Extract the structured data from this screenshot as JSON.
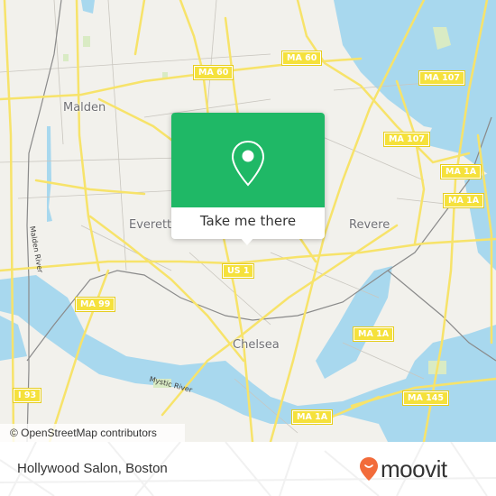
{
  "map": {
    "places": [
      {
        "id": "malden",
        "label": "Malden"
      },
      {
        "id": "everett",
        "label": "Everett"
      },
      {
        "id": "revere",
        "label": "Revere"
      },
      {
        "id": "chelsea",
        "label": "Chelsea"
      }
    ],
    "shields": [
      {
        "id": "ma60-a",
        "label": "MA 60"
      },
      {
        "id": "ma60-b",
        "label": "MA 60"
      },
      {
        "id": "ma107-a",
        "label": "MA 107"
      },
      {
        "id": "ma107-b",
        "label": "MA 107"
      },
      {
        "id": "ma1a-a",
        "label": "MA 1A"
      },
      {
        "id": "ma1a-b",
        "label": "MA 1A"
      },
      {
        "id": "ma1a-c",
        "label": "MA 1A"
      },
      {
        "id": "us1",
        "label": "US 1"
      },
      {
        "id": "ma99",
        "label": "MA 99"
      },
      {
        "id": "i93",
        "label": "I 93"
      },
      {
        "id": "ma145",
        "label": "MA 145"
      }
    ],
    "rivers": [
      {
        "id": "malden-river",
        "label": "Malden River"
      },
      {
        "id": "mystic-river",
        "label": "Mystic River"
      }
    ],
    "colors": {
      "land": "#f2f1ec",
      "water": "#a8d8ee",
      "road": "#f7e36a",
      "park": "#d9ebc4"
    },
    "attribution": "© OpenStreetMap contributors"
  },
  "popup": {
    "icon": "map-pin-icon",
    "cta_label": "Take me there",
    "color": "#1fb866"
  },
  "footer": {
    "place_name": "Hollywood Salon, Boston",
    "logo_text": "moovit",
    "logo_color": "#f26b3a"
  }
}
